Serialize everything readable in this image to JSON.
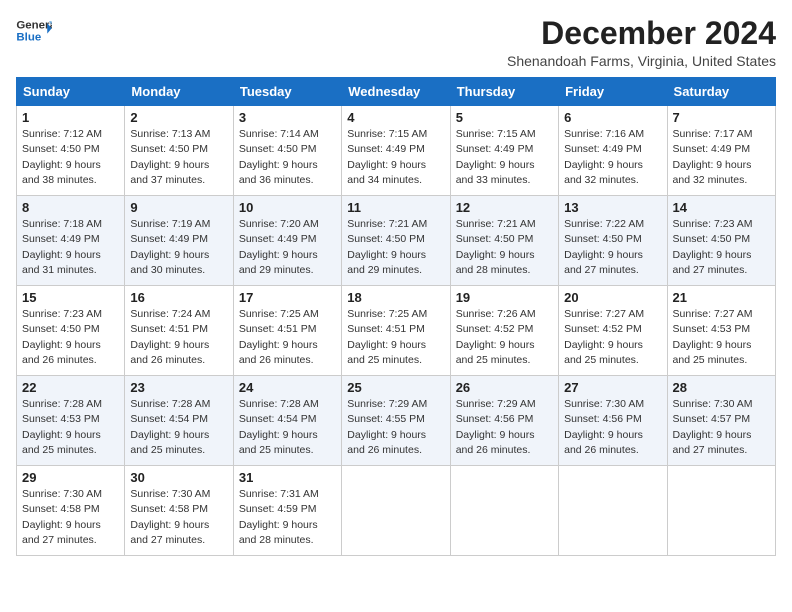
{
  "header": {
    "logo_line1": "General",
    "logo_line2": "Blue",
    "month_year": "December 2024",
    "location": "Shenandoah Farms, Virginia, United States"
  },
  "days_of_week": [
    "Sunday",
    "Monday",
    "Tuesday",
    "Wednesday",
    "Thursday",
    "Friday",
    "Saturday"
  ],
  "weeks": [
    [
      {
        "day": "1",
        "sunrise": "7:12 AM",
        "sunset": "4:50 PM",
        "daylight": "9 hours and 38 minutes."
      },
      {
        "day": "2",
        "sunrise": "7:13 AM",
        "sunset": "4:50 PM",
        "daylight": "9 hours and 37 minutes."
      },
      {
        "day": "3",
        "sunrise": "7:14 AM",
        "sunset": "4:50 PM",
        "daylight": "9 hours and 36 minutes."
      },
      {
        "day": "4",
        "sunrise": "7:15 AM",
        "sunset": "4:49 PM",
        "daylight": "9 hours and 34 minutes."
      },
      {
        "day": "5",
        "sunrise": "7:15 AM",
        "sunset": "4:49 PM",
        "daylight": "9 hours and 33 minutes."
      },
      {
        "day": "6",
        "sunrise": "7:16 AM",
        "sunset": "4:49 PM",
        "daylight": "9 hours and 32 minutes."
      },
      {
        "day": "7",
        "sunrise": "7:17 AM",
        "sunset": "4:49 PM",
        "daylight": "9 hours and 32 minutes."
      }
    ],
    [
      {
        "day": "8",
        "sunrise": "7:18 AM",
        "sunset": "4:49 PM",
        "daylight": "9 hours and 31 minutes."
      },
      {
        "day": "9",
        "sunrise": "7:19 AM",
        "sunset": "4:49 PM",
        "daylight": "9 hours and 30 minutes."
      },
      {
        "day": "10",
        "sunrise": "7:20 AM",
        "sunset": "4:49 PM",
        "daylight": "9 hours and 29 minutes."
      },
      {
        "day": "11",
        "sunrise": "7:21 AM",
        "sunset": "4:50 PM",
        "daylight": "9 hours and 29 minutes."
      },
      {
        "day": "12",
        "sunrise": "7:21 AM",
        "sunset": "4:50 PM",
        "daylight": "9 hours and 28 minutes."
      },
      {
        "day": "13",
        "sunrise": "7:22 AM",
        "sunset": "4:50 PM",
        "daylight": "9 hours and 27 minutes."
      },
      {
        "day": "14",
        "sunrise": "7:23 AM",
        "sunset": "4:50 PM",
        "daylight": "9 hours and 27 minutes."
      }
    ],
    [
      {
        "day": "15",
        "sunrise": "7:23 AM",
        "sunset": "4:50 PM",
        "daylight": "9 hours and 26 minutes."
      },
      {
        "day": "16",
        "sunrise": "7:24 AM",
        "sunset": "4:51 PM",
        "daylight": "9 hours and 26 minutes."
      },
      {
        "day": "17",
        "sunrise": "7:25 AM",
        "sunset": "4:51 PM",
        "daylight": "9 hours and 26 minutes."
      },
      {
        "day": "18",
        "sunrise": "7:25 AM",
        "sunset": "4:51 PM",
        "daylight": "9 hours and 25 minutes."
      },
      {
        "day": "19",
        "sunrise": "7:26 AM",
        "sunset": "4:52 PM",
        "daylight": "9 hours and 25 minutes."
      },
      {
        "day": "20",
        "sunrise": "7:27 AM",
        "sunset": "4:52 PM",
        "daylight": "9 hours and 25 minutes."
      },
      {
        "day": "21",
        "sunrise": "7:27 AM",
        "sunset": "4:53 PM",
        "daylight": "9 hours and 25 minutes."
      }
    ],
    [
      {
        "day": "22",
        "sunrise": "7:28 AM",
        "sunset": "4:53 PM",
        "daylight": "9 hours and 25 minutes."
      },
      {
        "day": "23",
        "sunrise": "7:28 AM",
        "sunset": "4:54 PM",
        "daylight": "9 hours and 25 minutes."
      },
      {
        "day": "24",
        "sunrise": "7:28 AM",
        "sunset": "4:54 PM",
        "daylight": "9 hours and 25 minutes."
      },
      {
        "day": "25",
        "sunrise": "7:29 AM",
        "sunset": "4:55 PM",
        "daylight": "9 hours and 26 minutes."
      },
      {
        "day": "26",
        "sunrise": "7:29 AM",
        "sunset": "4:56 PM",
        "daylight": "9 hours and 26 minutes."
      },
      {
        "day": "27",
        "sunrise": "7:30 AM",
        "sunset": "4:56 PM",
        "daylight": "9 hours and 26 minutes."
      },
      {
        "day": "28",
        "sunrise": "7:30 AM",
        "sunset": "4:57 PM",
        "daylight": "9 hours and 27 minutes."
      }
    ],
    [
      {
        "day": "29",
        "sunrise": "7:30 AM",
        "sunset": "4:58 PM",
        "daylight": "9 hours and 27 minutes."
      },
      {
        "day": "30",
        "sunrise": "7:30 AM",
        "sunset": "4:58 PM",
        "daylight": "9 hours and 27 minutes."
      },
      {
        "day": "31",
        "sunrise": "7:31 AM",
        "sunset": "4:59 PM",
        "daylight": "9 hours and 28 minutes."
      },
      null,
      null,
      null,
      null
    ]
  ]
}
